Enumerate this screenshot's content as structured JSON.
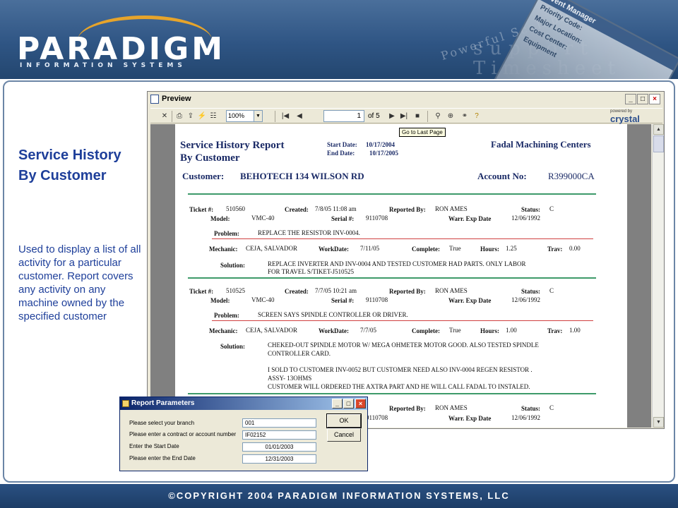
{
  "header": {
    "logo": "PARADIGM",
    "sublogo": "INFORMATION SYSTEMS",
    "tagline": "Powerful Scalable",
    "tagline2": "support",
    "tagline3": "Timesheet",
    "event_manager": {
      "title": "Event Manager",
      "rows": [
        "Priority Code:",
        "Major Location:",
        "Cost Center:",
        "Equipment"
      ]
    }
  },
  "sidebar": {
    "title": "Service History By Customer",
    "description": "Used to display a list of all activity for a particular customer. Report covers any activity on any machine owned by the specified customer"
  },
  "preview": {
    "title": "Preview",
    "toolbar": {
      "zoom": "100%",
      "page": "1",
      "of_pages": "of 5",
      "tooltip": "Go to Last Page",
      "powered_by": "powered by",
      "brand": "crystal"
    },
    "report": {
      "title_line1": "Service History Report",
      "title_line2": "By Customer",
      "start_date_label": "Start Date:",
      "start_date": "10/17/2004",
      "end_date_label": "End Date:",
      "end_date": "10/17/2005",
      "company": "Fadal Machining Centers",
      "customer_label": "Customer:",
      "customer": "BEHOTECH  134 WILSON RD",
      "account_label": "Account No:",
      "account": "R399000CA",
      "labels": {
        "ticket": "Ticket #:",
        "created": "Created:",
        "reported_by": "Reported By:",
        "status": "Status:",
        "model": "Model:",
        "serial": "Serial #:",
        "warr": "Warr. Exp Date",
        "problem": "Problem:",
        "mechanic": "Mechanic:",
        "workdate": "WorkDate:",
        "complete": "Complete:",
        "hours": "Hours:",
        "trav": "Trav:",
        "solution": "Solution:"
      },
      "tickets": [
        {
          "ticket": "510560",
          "created": "7/8/05 11:08 am",
          "reported_by": "RON AMES",
          "status": "C",
          "model": "VMC-40",
          "serial": "9110708",
          "warr": "12/06/1992",
          "problem": "REPLACE THE RESISTOR INV-0004.",
          "mechanic": "CEJA, SALVADOR",
          "workdate": "7/11/05",
          "complete": "True",
          "hours": "1.25",
          "trav": "0.00",
          "solution": [
            "REPLACE   INVERTER AND INV-0004 AND TESTED CUSTOMER HAD PARTS. ONLY LABOR",
            "FOR TRAVEL S/TIKET-J510525"
          ]
        },
        {
          "ticket": "510525",
          "created": "7/7/05 10:21 am",
          "reported_by": "RON AMES",
          "status": "C",
          "model": "VMC-40",
          "serial": "9110708",
          "warr": "12/06/1992",
          "problem": "SCREEN SAYS SPINDLE CONTROLLER OR DRIVER.",
          "mechanic": "CEJA, SALVADOR",
          "workdate": "7/7/05",
          "complete": "True",
          "hours": "1.00",
          "trav": "1.00",
          "solution": [
            "CHEKED-OUT SPINDLE MOTOR W/ MEGA OHMETER  MOTOR GOOD. ALSO  TESTED SPINDLE",
            "CONTROLLER CARD.",
            "I SOLD  TO CUSTOMER INV-0052 BUT CUSTOMER NEED  ALSO  INV-0004  REGEN RESISTOR .",
            "ASSY- 13OHMS",
            "CUSTOMER WILL ORDERED THE  AXTRA PART AND HE WILL CALL FADAL  TO INSTALED."
          ]
        },
        {
          "reported_by": "RON AMES",
          "status": "C",
          "serial": "9110708",
          "warr": "12/06/1992"
        }
      ]
    }
  },
  "dialog": {
    "title": "Report Parameters",
    "params": [
      {
        "label": "Please select your branch",
        "value": "001"
      },
      {
        "label": "Please enter a contract or account number",
        "value": "IF02152"
      },
      {
        "label": "Enter the Start Date",
        "value": "01/01/2003"
      },
      {
        "label": "Please enter the End Date",
        "value": "12/31/2003"
      }
    ],
    "ok": "OK",
    "cancel": "Cancel"
  },
  "footer": {
    "copyright": "©COPYRIGHT 2004 PARADIGM INFORMATION SYSTEMS, LLC"
  }
}
